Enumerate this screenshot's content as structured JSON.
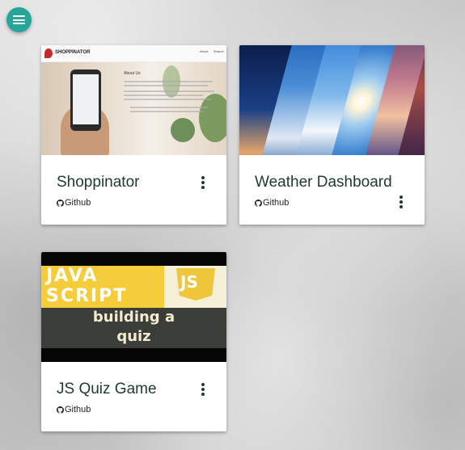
{
  "menu": {
    "icon": "hamburger-menu-icon"
  },
  "projects": [
    {
      "title": "Shoppinator",
      "link_label": "Github",
      "link_icon": "github-icon",
      "more_icon": "more-vertical-icon",
      "thumb": {
        "brand": "SHOPPINATOR",
        "nav": [
          "About",
          "Search"
        ],
        "heading": "About Us"
      }
    },
    {
      "title": "Weather Dashboard",
      "link_label": "Github",
      "link_icon": "github-icon",
      "more_icon": "more-vertical-icon",
      "thumb": {}
    },
    {
      "title": "JS Quiz Game",
      "link_label": "Github",
      "link_icon": "github-icon",
      "more_icon": "more-vertical-icon",
      "thumb": {
        "line1": "JAVA",
        "line2": "SCRIPT",
        "badge": "JS",
        "caption1": "building a",
        "caption2": "quiz"
      }
    }
  ],
  "colors": {
    "accent": "#26a69a",
    "title_text": "#1f3b2c"
  }
}
